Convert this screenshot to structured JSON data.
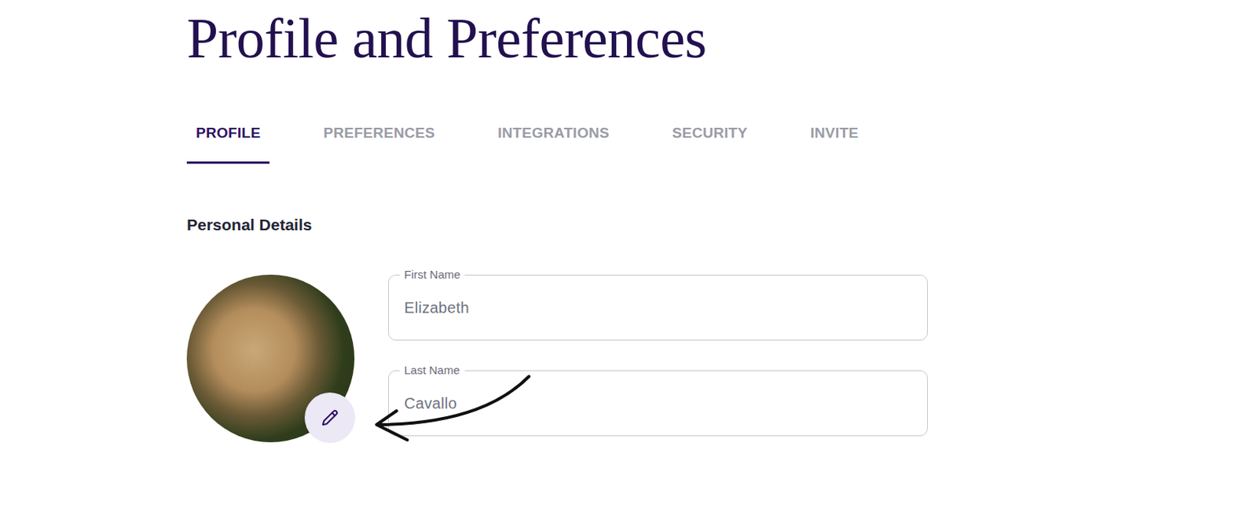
{
  "page": {
    "title": "Profile and Preferences"
  },
  "tabs": [
    {
      "label": "PROFILE",
      "selected": true
    },
    {
      "label": "PREFERENCES",
      "selected": false
    },
    {
      "label": "INTEGRATIONS",
      "selected": false
    },
    {
      "label": "SECURITY",
      "selected": false
    },
    {
      "label": "INVITE",
      "selected": false
    }
  ],
  "section": {
    "title": "Personal Details"
  },
  "fields": [
    {
      "label": "First Name",
      "value": "Elizabeth"
    },
    {
      "label": "Last Name",
      "value": "Cavallo"
    }
  ]
}
